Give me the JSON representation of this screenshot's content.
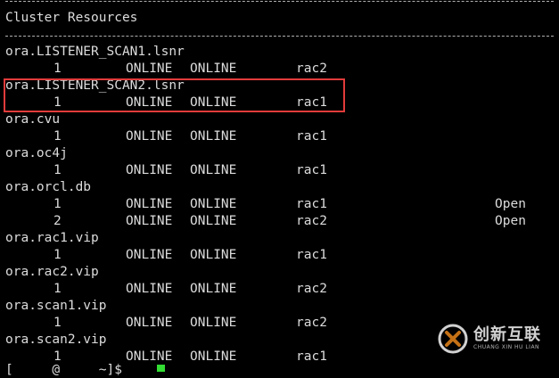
{
  "header": {
    "title": "Cluster Resources"
  },
  "resources": [
    {
      "name": "ora.LISTENER_SCAN1.lsnr",
      "instances": [
        {
          "num": "1",
          "target": "ONLINE",
          "state": "ONLINE",
          "server": "rac2",
          "details": ""
        }
      ]
    },
    {
      "name": "ora.LISTENER_SCAN2.lsnr",
      "instances": [
        {
          "num": "1",
          "target": "ONLINE",
          "state": "ONLINE",
          "server": "rac1",
          "details": ""
        }
      ]
    },
    {
      "name": "ora.cvu",
      "instances": [
        {
          "num": "1",
          "target": "ONLINE",
          "state": "ONLINE",
          "server": "rac1",
          "details": ""
        }
      ]
    },
    {
      "name": "ora.oc4j",
      "instances": [
        {
          "num": "1",
          "target": "ONLINE",
          "state": "ONLINE",
          "server": "rac1",
          "details": ""
        }
      ]
    },
    {
      "name": "ora.orcl.db",
      "instances": [
        {
          "num": "1",
          "target": "ONLINE",
          "state": "ONLINE",
          "server": "rac1",
          "details": "Open"
        },
        {
          "num": "2",
          "target": "ONLINE",
          "state": "ONLINE",
          "server": "rac2",
          "details": "Open"
        }
      ]
    },
    {
      "name": "ora.rac1.vip",
      "instances": [
        {
          "num": "1",
          "target": "ONLINE",
          "state": "ONLINE",
          "server": "rac1",
          "details": ""
        }
      ]
    },
    {
      "name": "ora.rac2.vip",
      "instances": [
        {
          "num": "1",
          "target": "ONLINE",
          "state": "ONLINE",
          "server": "rac2",
          "details": ""
        }
      ]
    },
    {
      "name": "ora.scan1.vip",
      "instances": [
        {
          "num": "1",
          "target": "ONLINE",
          "state": "ONLINE",
          "server": "rac2",
          "details": ""
        }
      ]
    },
    {
      "name": "ora.scan2.vip",
      "instances": [
        {
          "num": "1",
          "target": "ONLINE",
          "state": "ONLINE",
          "server": "rac1",
          "details": ""
        }
      ]
    }
  ],
  "prompt_partial": "[     @     ~]$",
  "watermark": {
    "name_cn": "创新互联",
    "name_en": "CHUANG XIN HU LIAN"
  },
  "colors": {
    "background": "#000000",
    "text": "#dcdcdc",
    "highlight_border": "#e23b3b",
    "cursor": "#33dd33"
  }
}
